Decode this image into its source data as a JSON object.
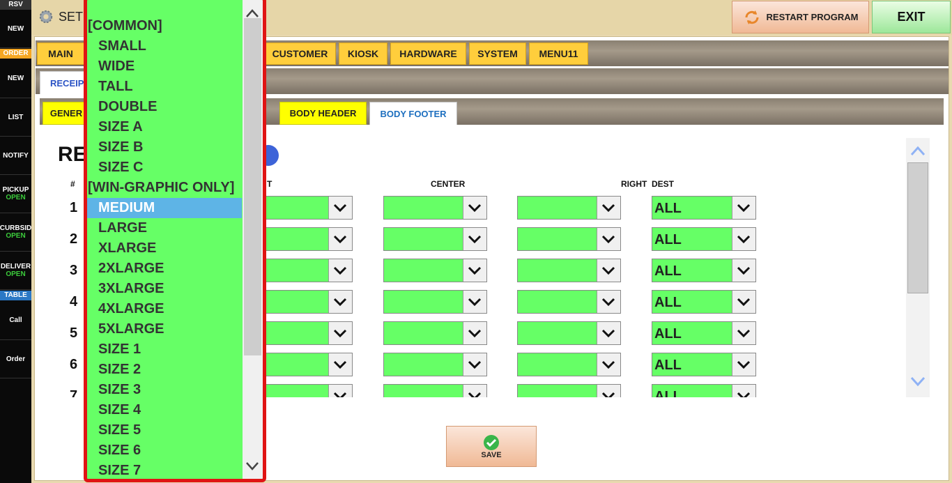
{
  "sidebar": {
    "rsv_header": "RSV",
    "rsv_new": "NEW",
    "order_header": "ORDER",
    "order_new": "NEW",
    "list": "LIST",
    "notify": "NOTIFY",
    "pickup": "PICKUP",
    "pickup_status": "OPEN",
    "curbside": "CURBSID",
    "curbside_status": "OPEN",
    "delivery": "DELIVER",
    "delivery_status": "OPEN",
    "table_header": "TABLE",
    "call": "Call",
    "order": "Order",
    "colors": {
      "order_header": "#f5a623",
      "table_header": "#2b78c5",
      "status": "#3ccc3c"
    }
  },
  "header": {
    "title": "SET",
    "restart_label": "RESTART PROGRAM",
    "exit_label": "EXIT"
  },
  "tabs_main": [
    "MAIN",
    "CUSTOMER",
    "KIOSK",
    "HARDWARE",
    "SYSTEM",
    "MENU11"
  ],
  "tabs_sub": {
    "receipt": "RECEIPT"
  },
  "tabs_section": {
    "general": "GENER",
    "body_header": "BODY HEADER",
    "body_footer": "BODY FOOTER",
    "active": "BODY FOOTER"
  },
  "content": {
    "title": "RE",
    "col_num": "#",
    "col_left_partial": "T",
    "col_center": "CENTER",
    "col_right": "RIGHT",
    "col_dest": "DEST",
    "rows": [
      "1",
      "2",
      "3",
      "4",
      "5",
      "6",
      "7"
    ],
    "dest_value": "ALL"
  },
  "save_label": "SAVE",
  "dropdown": {
    "options": [
      {
        "label": "[COMMON]",
        "group": true
      },
      {
        "label": "SMALL"
      },
      {
        "label": "WIDE"
      },
      {
        "label": "TALL"
      },
      {
        "label": "DOUBLE"
      },
      {
        "label": "SIZE A"
      },
      {
        "label": "SIZE B"
      },
      {
        "label": "SIZE C"
      },
      {
        "label": "[WIN-GRAPHIC ONLY]",
        "group": true
      },
      {
        "label": "MEDIUM",
        "selected": true
      },
      {
        "label": "LARGE"
      },
      {
        "label": "XLARGE"
      },
      {
        "label": "2XLARGE"
      },
      {
        "label": "3XLARGE"
      },
      {
        "label": "4XLARGE"
      },
      {
        "label": "5XLARGE"
      },
      {
        "label": "SIZE 1"
      },
      {
        "label": "SIZE 2"
      },
      {
        "label": "SIZE 3"
      },
      {
        "label": "SIZE 4"
      },
      {
        "label": "SIZE 5"
      },
      {
        "label": "SIZE 6"
      },
      {
        "label": "SIZE 7"
      }
    ],
    "colors": {
      "background": "#66ff66",
      "border": "#e01414",
      "selected": "#5eb4e6"
    }
  }
}
